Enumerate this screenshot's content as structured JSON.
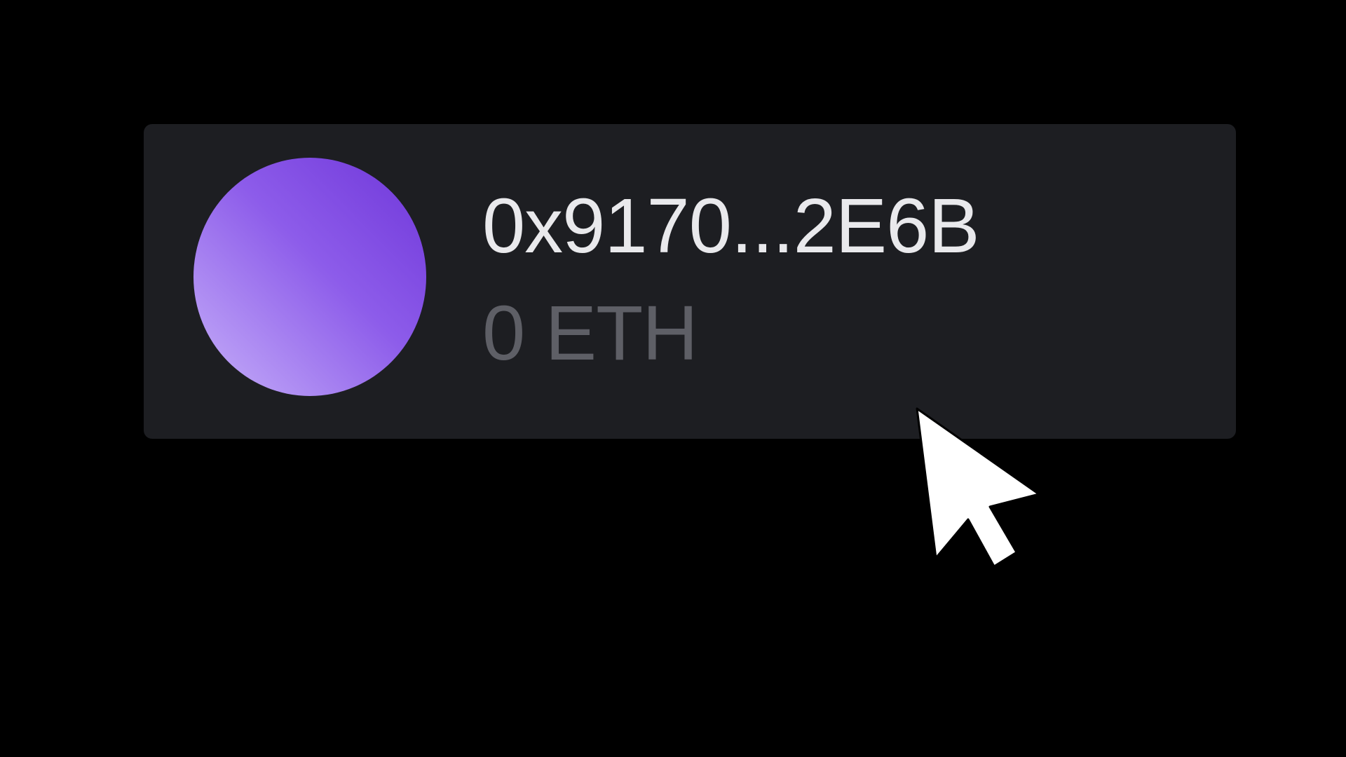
{
  "wallet": {
    "address": "0x9170...2E6B",
    "balance": "0 ETH"
  },
  "avatar": {
    "gradient_colors": [
      "#6f36d9",
      "#8d5cea",
      "#c7b1f9"
    ]
  },
  "colors": {
    "background": "#000000",
    "card": "#1d1e22",
    "address_text": "#e9e9ec",
    "balance_text": "#5e5f66"
  },
  "cursor": {
    "icon": "arrow-pointer-icon"
  }
}
